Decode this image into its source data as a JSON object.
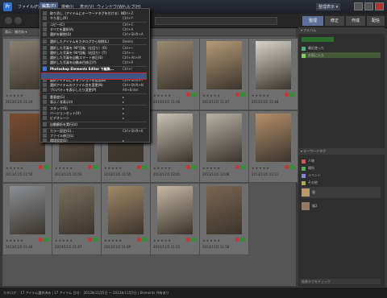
{
  "menubar": {
    "app_icon": "Pr",
    "items": [
      "ファイル(F)",
      "編集(E)",
      "検索(I)",
      "表示(V)",
      "ウィンドウ(W)",
      "ヘルプ(H)"
    ],
    "right_label": "整理表示 ▾"
  },
  "tabs": [
    "整理",
    "修正",
    "作成",
    "配信"
  ],
  "sort_label": "表示：順方向 ▾",
  "right_panel": {
    "album_head": "▾ アルバム",
    "albums": [
      "最近使った",
      "お気に入り"
    ],
    "tags_head": "▾ キーワードタグ",
    "tags": [
      "人物",
      "場所",
      "イベント",
      "その他",
      "猫",
      "猫2"
    ],
    "bottom_label": "画像タグをチェック"
  },
  "dropdown": {
    "items": [
      {
        "label": "取り消し（アイテムにキーワードタグを付ける）(U)",
        "shortcut": "Ctrl+Z"
      },
      {
        "label": "やり直し(R)",
        "shortcut": "Ctrl+Y"
      },
      {
        "label": "コピー(C)",
        "shortcut": "Ctrl+C"
      },
      {
        "label": "すべてを選択(A)",
        "shortcut": "Ctrl+A"
      },
      {
        "label": "選択を解除(D)",
        "shortcut": "Ctrl+Shift+A"
      },
      {
        "label": "選択したアイテムをカタログから削除(L)",
        "shortcut": "Delete"
      },
      {
        "label": "選択した写真を 90°回転（左回り）(O)",
        "shortcut": "Ctrl+←"
      },
      {
        "label": "選択した写真を 90°回転（右回り）(T)",
        "shortcut": "Ctrl+→"
      },
      {
        "label": "選択した写真を自動スマート修正(E)",
        "shortcut": "Ctrl+Alt+M"
      },
      {
        "label": "選択した写真を自動赤目修正(Y)",
        "shortcut": "Ctrl+R"
      },
      {
        "label": "Photoshop Elements Editor で編集...",
        "shortcut": "Ctrl+I"
      },
      {
        "label": "選択アイテムの日付と時刻を変更(H)",
        "shortcut": "Ctrl+J"
      },
      {
        "label": "選択アイテムにキャプションを追加(B)",
        "shortcut": "Ctrl+Shift+T"
      },
      {
        "label": "選択アイテムのファイル名を変更(N)",
        "shortcut": "Ctrl+Shift+N"
      },
      {
        "label": "プロパティを表示したり変更(P)",
        "shortcut": "Alt+Enter"
      },
      {
        "label": "重要度(G)",
        "shortcut": "▸"
      },
      {
        "label": "表示 / 非表示(I)",
        "shortcut": "▸"
      },
      {
        "label": "スタック(S)",
        "shortcut": "▸"
      },
      {
        "label": "バージョンセット(V)",
        "shortcut": "▸"
      },
      {
        "label": "ビデオシーン",
        "shortcut": "▸"
      },
      {
        "label": "自動解析を実行(U)",
        "shortcut": ""
      },
      {
        "label": "カラー設定(G)...",
        "shortcut": "Ctrl+Shift+K"
      },
      {
        "label": "ファイル修正(L)",
        "shortcut": ""
      },
      {
        "label": "環境設定(E)",
        "shortcut": "▸"
      }
    ]
  },
  "photos": [
    {
      "date": "2013/11/5 11:24",
      "color": "#8a7f72"
    },
    {
      "date": "2013/11/5 11:32",
      "color": "#5a5040"
    },
    {
      "date": "2013/11/5 11:45",
      "color": "#6b6552"
    },
    {
      "date": "2013/11/5 11:46",
      "color": "#9a8a70"
    },
    {
      "date": "2013/11/5 11:47",
      "color": "#b59a75"
    },
    {
      "date": "2013/11/5 11:48",
      "color": "#d8d4cc"
    },
    {
      "date": "2013/11/5 11:50",
      "color": "#7b4c30"
    },
    {
      "date": "2013/11/5 11:54",
      "color": "#6a5f50"
    },
    {
      "date": "2013/11/5 11:55",
      "color": "#4a4236"
    },
    {
      "date": "2013/11/5 12:01",
      "color": "#c9c2b6"
    },
    {
      "date": "2013/11/5 12:08",
      "color": "#b7b0a5"
    },
    {
      "date": "2013/11/5 12:11",
      "color": "#b48f6a"
    },
    {
      "date": "2013/11/5 11:40",
      "color": "#8b8f95"
    },
    {
      "date": "2013/11/5 11:47",
      "color": "#7a6f60"
    },
    {
      "date": "2013/11/5 11:49",
      "color": "#a28866"
    },
    {
      "date": "2013/11/5 11:51",
      "color": "#c6b9a4"
    },
    {
      "date": "2013/11/5 11:58",
      "color": "#7a6650"
    }
  ],
  "stars": "★★★★★",
  "status": "カタログ： 17 アイテム選択済み  |  17 アイテム  日付： 2013年11月5日 ～ 2013年11月5日  |  Elements 共有あり"
}
